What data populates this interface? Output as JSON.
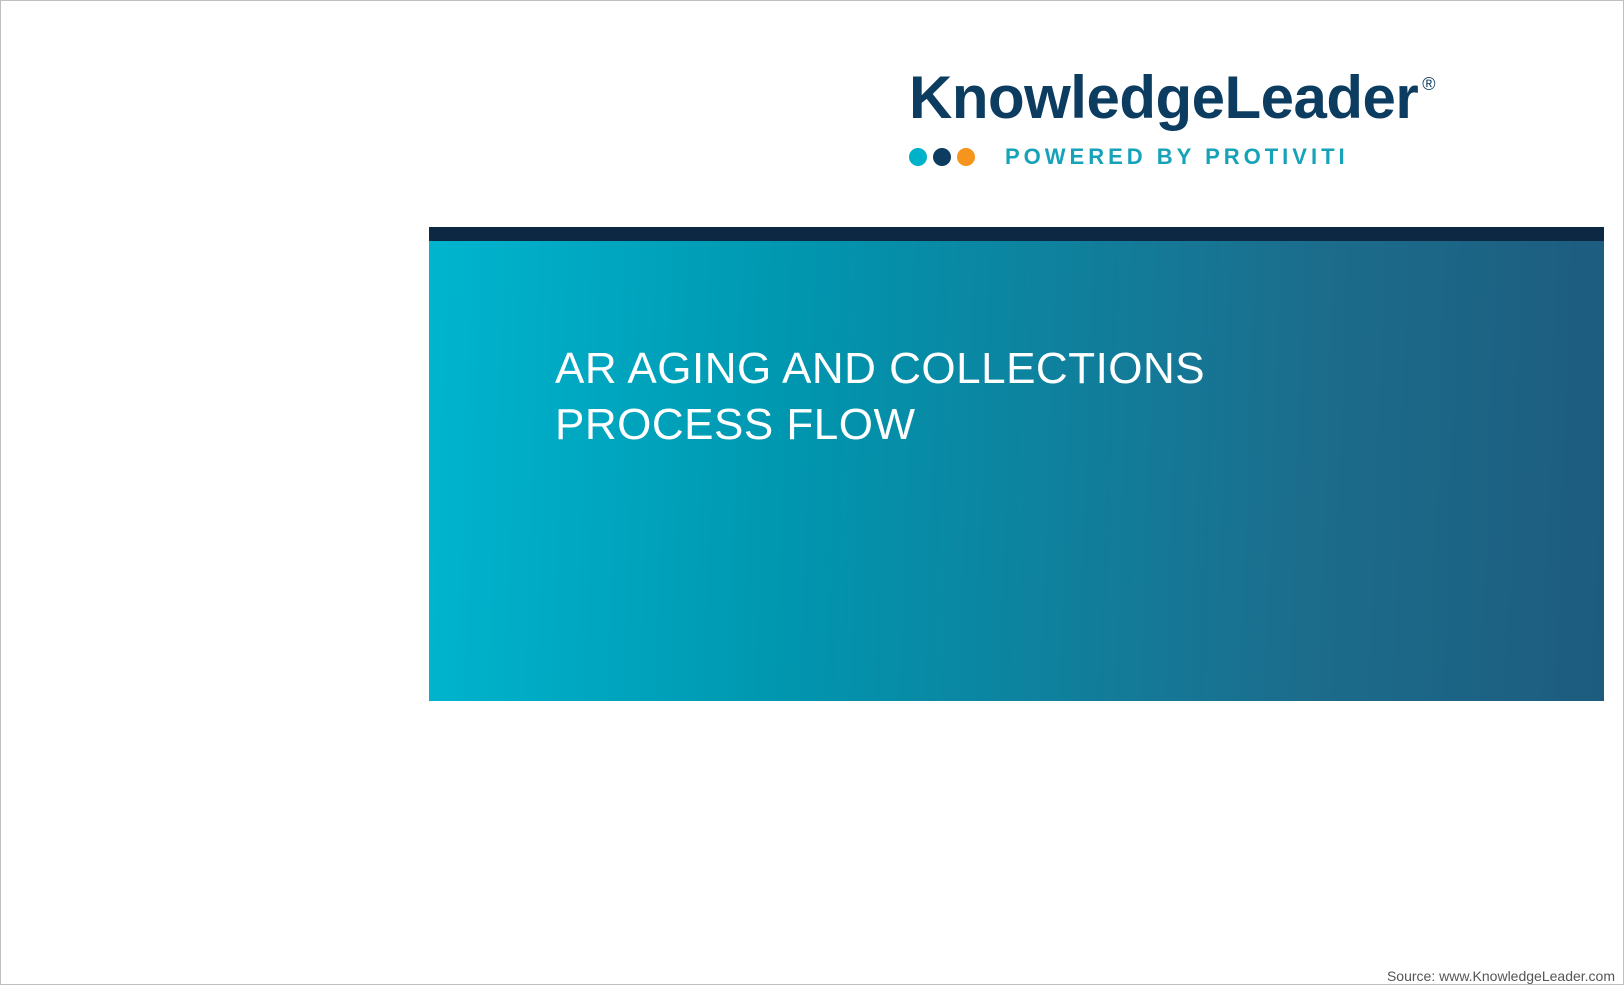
{
  "logo": {
    "wordmark": "KnowledgeLeader",
    "registered": "®",
    "tagline": "POWERED BY PROTIVITI"
  },
  "panel": {
    "title_line1": "AR AGING AND COLLECTIONS",
    "title_line2": "PROCESS FLOW"
  },
  "footer": {
    "source": "Source: www.KnowledgeLeader.com"
  }
}
